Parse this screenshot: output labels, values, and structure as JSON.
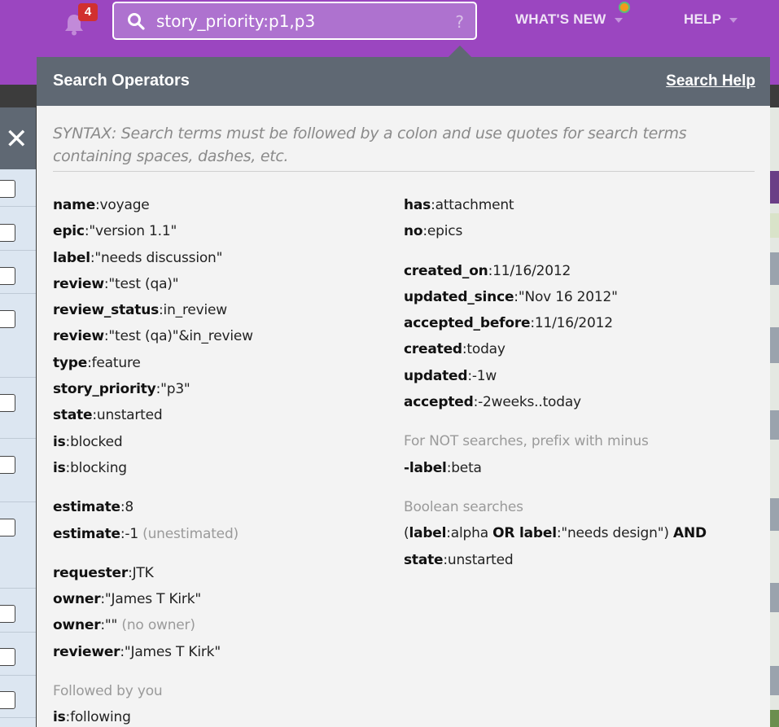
{
  "topbar": {
    "notification_count": "4",
    "search_value": "story_priority:p1,p3",
    "search_help_glyph": "?",
    "whats_new_label": "WHAT'S NEW",
    "help_label": "HELP",
    "colors": {
      "bar": "#9b46c0",
      "badge": "#d1302f"
    }
  },
  "left_pane": {
    "close_glyph": "✕"
  },
  "popup": {
    "title": "Search Operators",
    "help_link": "Search Help",
    "syntax": "SYNTAX: Search terms must be followed by a colon and use quotes for search terms containing spaces, dashes, etc.",
    "left": {
      "group1": [
        {
          "key": "name",
          "value": ":voyage"
        },
        {
          "key": "epic",
          "value": ":\"version 1.1\""
        },
        {
          "key": "label",
          "value": ":\"needs discussion\""
        },
        {
          "key": "review",
          "value": ":\"test (qa)\""
        },
        {
          "key": "review_status",
          "value": ":in_review"
        },
        {
          "key": "review",
          "value": ":\"test (qa)\"&in_review"
        },
        {
          "key": "type",
          "value": ":feature"
        },
        {
          "key": "story_priority",
          "value": ":\"p3\""
        },
        {
          "key": "state",
          "value": ":unstarted"
        },
        {
          "key": "is",
          "value": ":blocked"
        },
        {
          "key": "is",
          "value": ":blocking"
        }
      ],
      "group2": [
        {
          "key": "estimate",
          "value": ":8",
          "note": ""
        },
        {
          "key": "estimate",
          "value": ":-1",
          "note": "(unestimated)"
        }
      ],
      "group3": [
        {
          "key": "requester",
          "value": ":JTK",
          "note": ""
        },
        {
          "key": "owner",
          "value": ":\"James T Kirk\"",
          "note": ""
        },
        {
          "key": "owner",
          "value": ":\"\"",
          "note": "(no owner)"
        },
        {
          "key": "reviewer",
          "value": ":\"James T Kirk\"",
          "note": ""
        }
      ],
      "followed_heading": "Followed by you",
      "followed": {
        "key": "is",
        "value": ":following"
      }
    },
    "right": {
      "group1": [
        {
          "key": "has",
          "value": ":attachment"
        },
        {
          "key": "no",
          "value": ":epics"
        }
      ],
      "group2": [
        {
          "key": "created_on",
          "value": ":11/16/2012"
        },
        {
          "key": "updated_since",
          "value": ":\"Nov 16 2012\""
        },
        {
          "key": "accepted_before",
          "value": ":11/16/2012"
        },
        {
          "key": "created",
          "value": ":today"
        },
        {
          "key": "updated",
          "value": ":-1w"
        },
        {
          "key": "accepted",
          "value": ":-2weeks..today"
        }
      ],
      "not_heading": "For NOT searches, prefix with minus",
      "not_example": {
        "key": "-label",
        "value": ":beta"
      },
      "bool_heading": "Boolean searches",
      "bool_line1": {
        "open": "(",
        "k1": "label",
        "v1": ":alpha ",
        "op1": "OR",
        "k2": " label",
        "v2": ":\"needs design\") ",
        "op2": "AND"
      },
      "bool_line2": {
        "key": "state",
        "value": ":unstarted"
      }
    }
  }
}
